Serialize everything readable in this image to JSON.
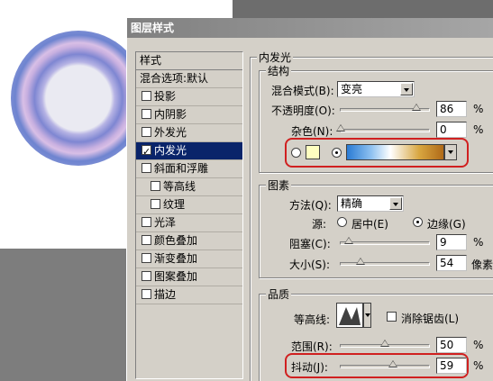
{
  "dialog": {
    "title": "图层样式"
  },
  "styles_panel": {
    "header": "样式",
    "items": [
      {
        "label": "混合选项:默认",
        "checkbox": false,
        "checked": false,
        "selected": false,
        "indent": false
      },
      {
        "label": "投影",
        "checkbox": true,
        "checked": false,
        "selected": false,
        "indent": false
      },
      {
        "label": "内阴影",
        "checkbox": true,
        "checked": false,
        "selected": false,
        "indent": false
      },
      {
        "label": "外发光",
        "checkbox": true,
        "checked": false,
        "selected": false,
        "indent": false
      },
      {
        "label": "内发光",
        "checkbox": true,
        "checked": true,
        "selected": true,
        "indent": false
      },
      {
        "label": "斜面和浮雕",
        "checkbox": true,
        "checked": false,
        "selected": false,
        "indent": false
      },
      {
        "label": "等高线",
        "checkbox": true,
        "checked": false,
        "selected": false,
        "indent": true
      },
      {
        "label": "纹理",
        "checkbox": true,
        "checked": false,
        "selected": false,
        "indent": true
      },
      {
        "label": "光泽",
        "checkbox": true,
        "checked": false,
        "selected": false,
        "indent": false
      },
      {
        "label": "颜色叠加",
        "checkbox": true,
        "checked": false,
        "selected": false,
        "indent": false
      },
      {
        "label": "渐变叠加",
        "checkbox": true,
        "checked": false,
        "selected": false,
        "indent": false
      },
      {
        "label": "图案叠加",
        "checkbox": true,
        "checked": false,
        "selected": false,
        "indent": false
      },
      {
        "label": "描边",
        "checkbox": true,
        "checked": false,
        "selected": false,
        "indent": false
      }
    ]
  },
  "inner_glow": {
    "title": "内发光",
    "structure": {
      "title": "结构",
      "blend_mode_label": "混合模式(B):",
      "blend_mode_value": "变亮",
      "opacity_label": "不透明度(O):",
      "opacity_value": "86",
      "opacity_fraction": 0.86,
      "noise_label": "杂色(N):",
      "noise_value": "0",
      "noise_fraction": 0.0,
      "percent": "%",
      "swatch_color": "#ffffc0",
      "color_mode": "gradient"
    },
    "elements": {
      "title": "图素",
      "method_label": "方法(Q):",
      "method_value": "精确",
      "source_label": "源:",
      "source_center_label": "居中(E)",
      "source_edge_label": "边缘(G)",
      "source_value": "edge",
      "choke_label": "阻塞(C):",
      "choke_value": "9",
      "choke_fraction": 0.09,
      "size_label": "大小(S):",
      "size_value": "54",
      "size_fraction": 0.22,
      "percent": "%",
      "pixels": "像素"
    },
    "quality": {
      "title": "品质",
      "contour_label": "等高线:",
      "anti_alias_label": "消除锯齿(L)",
      "anti_alias_checked": false,
      "range_label": "范围(R):",
      "range_value": "50",
      "range_fraction": 0.5,
      "jitter_label": "抖动(J):",
      "jitter_value": "59",
      "jitter_fraction": 0.59,
      "percent": "%"
    }
  },
  "highlight_color": "#d02020",
  "accent_color": "#0a246a"
}
